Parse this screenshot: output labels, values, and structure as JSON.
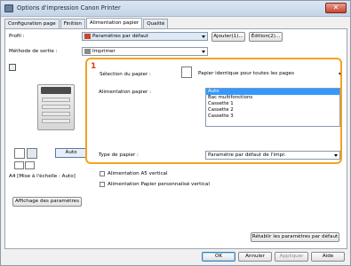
{
  "window": {
    "title": "Options d'impression Canon Printer",
    "close_label": "✕"
  },
  "tabs": [
    "Configuration page",
    "Finition",
    "Alimentation papier",
    "Qualité"
  ],
  "active_tab": 2,
  "profile": {
    "label": "Profil :",
    "value": "Paramètres par défaut",
    "add_label": "Ajouter(1)...",
    "edit_label": "Édition(2)..."
  },
  "output": {
    "label": "Méthode de sortie :",
    "value": "Imprimer"
  },
  "preview": {
    "size_label": "A4 [Mise à l'échelle : Auto]",
    "auto_label": "Auto"
  },
  "paper_selection": {
    "label": "Sélection du papier :",
    "value": "Papier identique pour toutes les pages"
  },
  "paper_source": {
    "number": "1",
    "label": "Alimentation papier :",
    "items": [
      "Auto",
      "Bac multifonctions",
      "Cassette 1",
      "Cassette 2",
      "Cassette 3"
    ],
    "selected": 0
  },
  "paper_type": {
    "label": "Type de papier :",
    "value": "Paramètre par défaut de l'impr."
  },
  "checkboxes": [
    "Alimentation A5 vertical",
    "Alimentation Papier personnalisé vertical"
  ],
  "show_settings_label": "Affichage des paramètres",
  "restore_label": "Rétablir les paramètres par défaut",
  "buttons": {
    "ok": "OK",
    "cancel": "Annuler",
    "apply": "Appliquer",
    "help": "Aide"
  },
  "colors": {
    "highlight": "#f4a21e",
    "number": "#e4371d",
    "selection": "#3399ff"
  }
}
